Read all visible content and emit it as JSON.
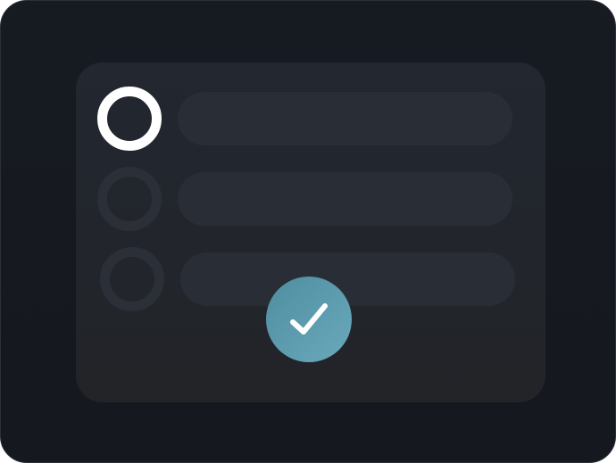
{
  "options": {
    "items": [
      {
        "selected": true
      },
      {
        "selected": false
      },
      {
        "selected": false
      }
    ]
  },
  "confirm": {
    "icon": "checkmark-icon",
    "color": "#5b9cae"
  },
  "colors": {
    "background": "#161a20",
    "panel": "#22262d",
    "bar": "#292d35",
    "radio_inactive": "#2b3038",
    "radio_active": "#ffffff",
    "check_badge": "#5b9cae"
  }
}
